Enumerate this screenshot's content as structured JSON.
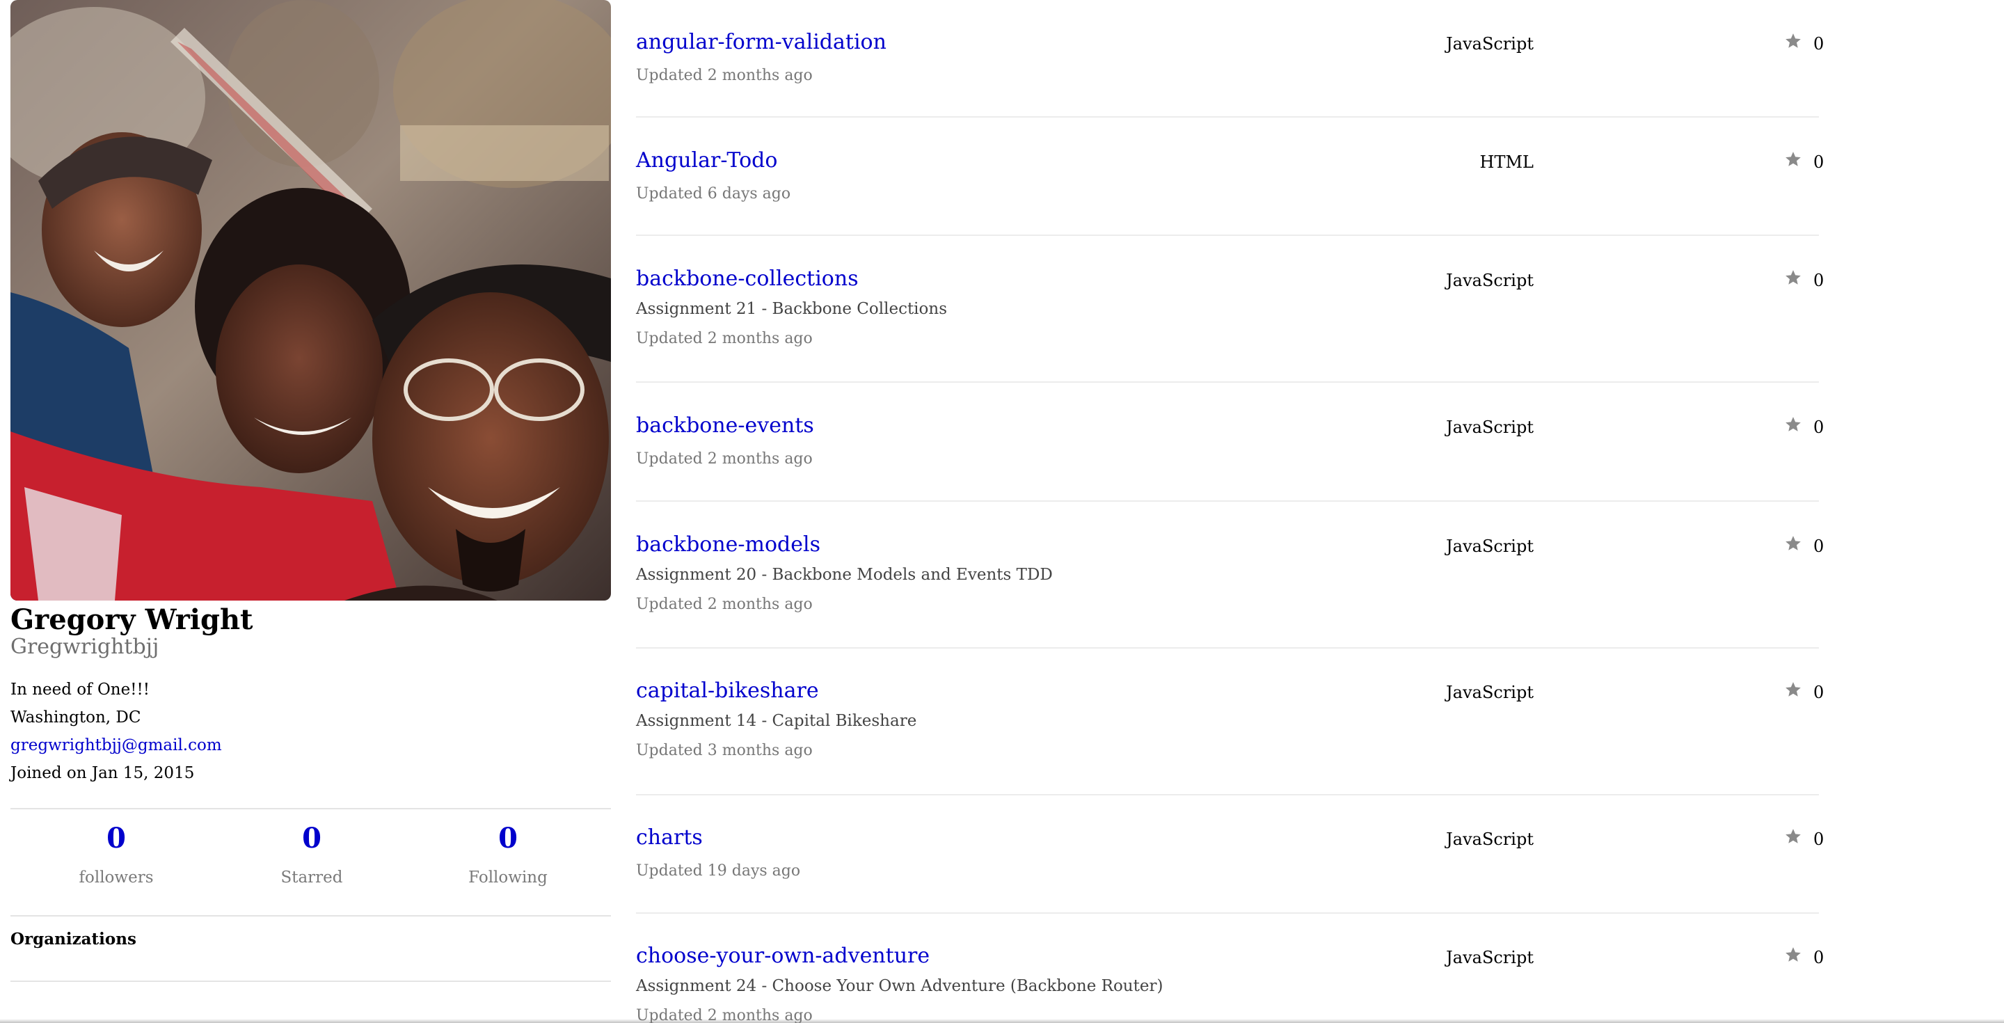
{
  "profile": {
    "name": "Gregory Wright",
    "username": "Gregwrightbjj",
    "bio": "In need of One!!!",
    "location": "Washington, DC",
    "email": "gregwrightbjj@gmail.com",
    "joined": "Joined on Jan 15, 2015"
  },
  "stats": {
    "followers": {
      "count": "0",
      "label": "followers"
    },
    "starred": {
      "count": "0",
      "label": "Starred"
    },
    "following": {
      "count": "0",
      "label": "Following"
    }
  },
  "organizations": {
    "heading": "Organizations"
  },
  "repos": [
    {
      "name": "angular-form-validation",
      "description": "",
      "updated": "Updated 2 months ago",
      "language": "JavaScript",
      "stars": "0"
    },
    {
      "name": "Angular-Todo",
      "description": "",
      "updated": "Updated 6 days ago",
      "language": "HTML",
      "stars": "0"
    },
    {
      "name": "backbone-collections",
      "description": "Assignment 21 - Backbone Collections",
      "updated": "Updated 2 months ago",
      "language": "JavaScript",
      "stars": "0"
    },
    {
      "name": "backbone-events",
      "description": "",
      "updated": "Updated 2 months ago",
      "language": "JavaScript",
      "stars": "0"
    },
    {
      "name": "backbone-models",
      "description": "Assignment 20 - Backbone Models and Events TDD",
      "updated": "Updated 2 months ago",
      "language": "JavaScript",
      "stars": "0"
    },
    {
      "name": "capital-bikeshare",
      "description": "Assignment 14 - Capital Bikeshare",
      "updated": "Updated 3 months ago",
      "language": "JavaScript",
      "stars": "0"
    },
    {
      "name": "charts",
      "description": "",
      "updated": "Updated 19 days ago",
      "language": "JavaScript",
      "stars": "0"
    },
    {
      "name": "choose-your-own-adventure",
      "description": "Assignment 24 - Choose Your Own Adventure (Backbone Router)",
      "updated": "Updated 2 months ago",
      "language": "JavaScript",
      "stars": "0"
    }
  ],
  "icons": {
    "star": "star-icon"
  },
  "colors": {
    "link": "#0000cc",
    "muted": "#777777",
    "divider": "#ececec",
    "star": "#8a8a8a"
  }
}
